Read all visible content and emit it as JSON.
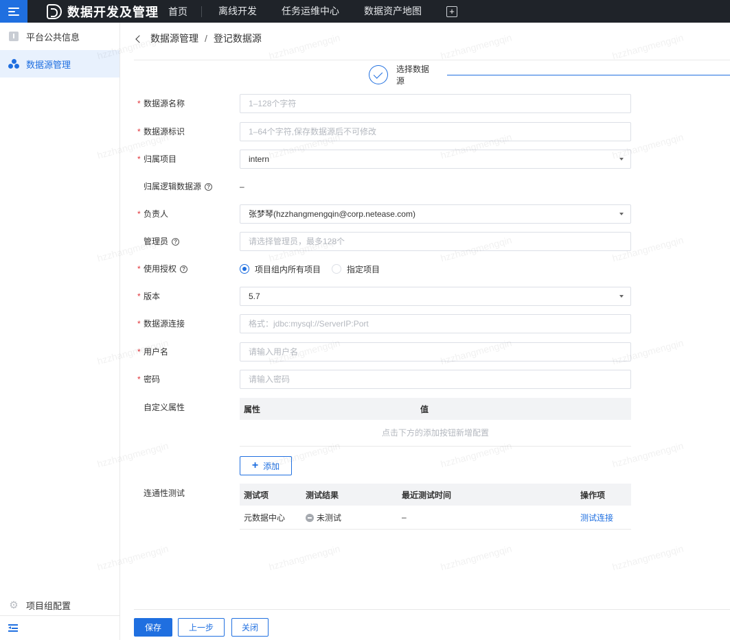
{
  "app": {
    "title": "数据开发及管理"
  },
  "nav": [
    "首页",
    "离线开发",
    "任务运维中心",
    "数据资产地图"
  ],
  "sidebar": {
    "items": [
      {
        "label": "平台公共信息",
        "icon": "doc-icon"
      },
      {
        "label": "数据源管理",
        "icon": "cluster-icon",
        "active": true
      }
    ],
    "bottom_label": "项目组配置"
  },
  "breadcrumb": {
    "parent": "数据源管理",
    "separator": "/",
    "current": "登记数据源"
  },
  "step": {
    "label": "选择数据源"
  },
  "form": {
    "name": {
      "label": "数据源名称",
      "placeholder": "1–128个字符"
    },
    "identifier": {
      "label": "数据源标识",
      "placeholder": "1–64个字符,保存数据源后不可修改"
    },
    "project": {
      "label": "归属项目",
      "value": "intern"
    },
    "logical": {
      "label": "归属逻辑数据源",
      "value": "–"
    },
    "owner": {
      "label": "负责人",
      "value": "张梦琴(hzzhangmengqin@corp.netease.com)"
    },
    "admin": {
      "label": "管理员",
      "placeholder": "请选择管理员，最多128个"
    },
    "auth": {
      "label": "使用授权",
      "options": [
        "项目组内所有项目",
        "指定项目"
      ],
      "selected": 0
    },
    "version": {
      "label": "版本",
      "value": "5.7"
    },
    "connection": {
      "label": "数据源连接",
      "placeholder": "格式：jdbc:mysql://ServerIP:Port"
    },
    "username": {
      "label": "用户名",
      "placeholder": "请输入用户名"
    },
    "password": {
      "label": "密码",
      "placeholder": "请输入密码"
    },
    "custom_props": {
      "label": "自定义属性",
      "headers": [
        "属性",
        "值"
      ],
      "empty_text": "点击下方的添加按钮新增配置",
      "add_label": "添加"
    },
    "connectivity": {
      "label": "连通性测试",
      "headers": [
        "测试项",
        "测试结果",
        "最近测试时间",
        "操作项"
      ],
      "rows": [
        {
          "item": "元数据中心",
          "result": "未测试",
          "time": "–",
          "action": "测试连接"
        }
      ]
    }
  },
  "footer": {
    "save": "保存",
    "prev": "上一步",
    "close": "关闭"
  },
  "watermark": "hzzhangmengqin"
}
